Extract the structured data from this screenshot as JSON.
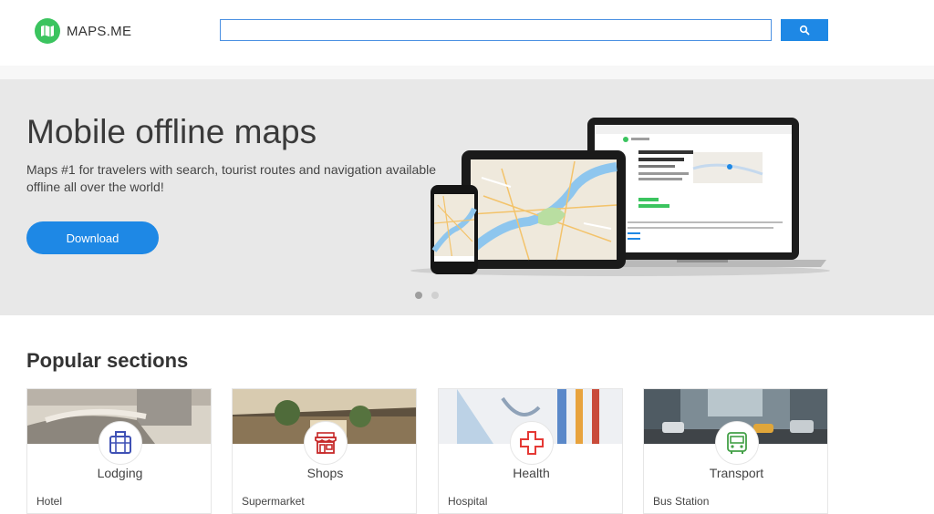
{
  "header": {
    "brand": "MAPS.ME",
    "search": {
      "value": "",
      "placeholder": ""
    },
    "search_icon": "search-icon"
  },
  "hero": {
    "title": "Mobile offline maps",
    "subtitle": "Maps #1 for travelers with search, tourist routes and navigation available offline all over the world!",
    "download_label": "Download",
    "slides": [
      {
        "active": true
      },
      {
        "active": false
      }
    ]
  },
  "popular": {
    "title": "Popular sections",
    "cards": [
      {
        "title": "Lodging",
        "sub": "Hotel",
        "icon": "suitcase-icon",
        "color": "#3f51b5"
      },
      {
        "title": "Shops",
        "sub": "Supermarket",
        "icon": "store-icon",
        "color": "#c62828"
      },
      {
        "title": "Health",
        "sub": "Hospital",
        "icon": "medical-cross-icon",
        "color": "#e53935"
      },
      {
        "title": "Transport",
        "sub": "Bus Station",
        "icon": "bus-icon",
        "color": "#43a047"
      }
    ]
  },
  "colors": {
    "brand_green": "#3bc45f",
    "accent_blue": "#1e88e5",
    "hero_bg": "#e8e8e8"
  }
}
